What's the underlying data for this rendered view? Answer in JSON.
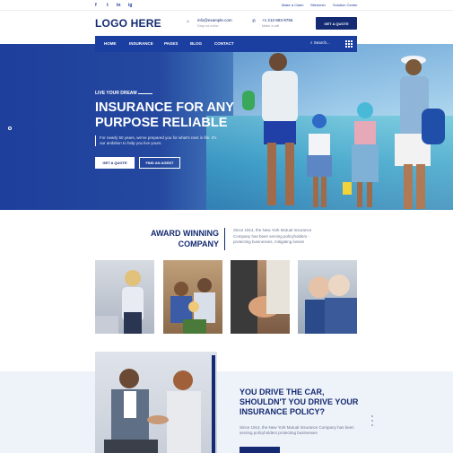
{
  "topbar": {
    "social": [
      "f",
      "t",
      "in",
      "ig"
    ],
    "links": [
      "Make a Claim",
      "Sitemesh",
      "Solution Center"
    ]
  },
  "header": {
    "logo": "LOGO HERE",
    "email": "info@example.com",
    "email_sub": "Drop us a line",
    "phone": "+1 212-683-9756",
    "phone_sub": "Make a call",
    "quote_button": "GET A QUOTE"
  },
  "nav": {
    "items": [
      "HOME",
      "INSURANCE",
      "PAGES",
      "BLOG",
      "CONTACT"
    ],
    "search_label": "Search...",
    "grid_icon": "grid-icon"
  },
  "hero": {
    "eyebrow": "LIVE YOUR DREAM",
    "title": "INSURANCE FOR ANY PURPOSE RELIABLE",
    "description": "For nearly 50 years, we've prepared you for what's next in life. It's our ambition to help you live yours.",
    "btn_quote": "GET A QUOTE",
    "btn_agent": "FIND AN AGENT"
  },
  "award": {
    "title_line1": "AWARD WINNING",
    "title_line2": "COMPANY",
    "text": "Since 1914, the New York Mutual Insurance Company has been serving policyholders - protecting businesses, mitigating losses"
  },
  "drive": {
    "title": "YOU DRIVE THE CAR, SHOULDN'T YOU DRIVE YOUR INSURANCE POLICY?",
    "text": "Since 1914, the New York Mutual Insurance Company has been serving policyholders protecting businesses"
  },
  "colors": {
    "primary": "#142a72",
    "nav": "#1b3fa0",
    "hero": "#1e3f9c",
    "band": "#eef2f9"
  }
}
